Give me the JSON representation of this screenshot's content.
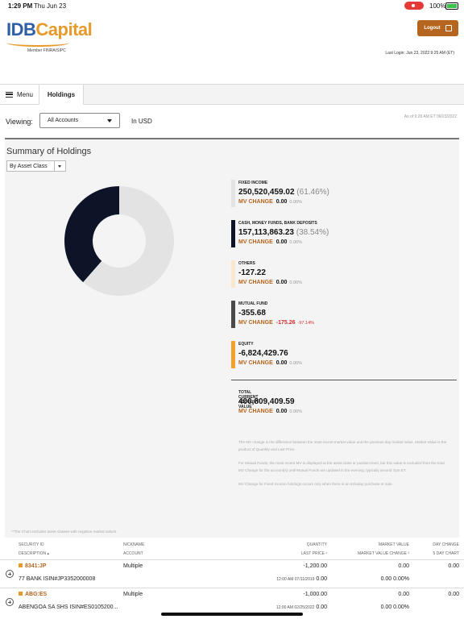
{
  "status_bar": {
    "time": "1:29 PM",
    "date": "Thu Jun 23",
    "battery": "100%"
  },
  "header": {
    "logo_idb": "IDB",
    "logo_capital": "Capital",
    "member": "Member FINRA/SIPC",
    "logout_label": "Logout",
    "last_login": "Last Login: Jun 23, 2022 9:25 AM (ET)"
  },
  "tabs": {
    "menu": "Menu",
    "holdings": "Holdings"
  },
  "toolbar": {
    "viewing_label": "Viewing:",
    "account_select": "All Accounts",
    "currency": "In USD",
    "as_of": "As of 9:29 AM ET 06/23/2022"
  },
  "summary": {
    "title": "Summary of Holdings",
    "group_by": "By Asset Class",
    "mv_change_label": "MV CHANGE",
    "items": [
      {
        "category": "FIXED INCOME",
        "value": "250,520,459.02",
        "pct": "(61.46%)",
        "mv_change": "0.00",
        "mv_pct": "0.00%",
        "color": "#e3e3e3"
      },
      {
        "category": "CASH, MONEY FUNDS, BANK DEPOSITS",
        "value": "157,113,863.23",
        "pct": "(38.54%)",
        "mv_change": "0.00",
        "mv_pct": "0.00%",
        "color": "#0d1428"
      },
      {
        "category": "OTHERS",
        "value": "-127.22",
        "pct": "",
        "mv_change": "0.00",
        "mv_pct": "0.00%",
        "color": "#fbe6cf"
      },
      {
        "category": "MUTUAL FUND",
        "value": "-355.68",
        "pct": "",
        "mv_change": "-175.26",
        "mv_pct": "-97.14%",
        "color": "#4a4a4a"
      },
      {
        "category": "EQUITY",
        "value": "-6,824,429.76",
        "pct": "",
        "mv_change": "0.00",
        "mv_pct": "0.00%",
        "color": "#f2a22c"
      }
    ],
    "total": {
      "label": "TOTAL CURRENT ACCOUNT VALUE",
      "value": "400,809,409.59",
      "mv_change": "0.00",
      "mv_pct": "0.00%"
    },
    "notes": [
      "The MV change is the difference between the most recent market value and the previous day market value. Market Value is the product of Quantity and Last Price.",
      "For Mutual Funds, the most recent MV is displayed at the asset class or position level, but this value is excluded from the total MV Change for the account(s) until Mutual Funds are updated in the evening, typically around 7pm ET.",
      "MV Change for Fixed Income holdings occurs only when there is an intraday purchase or sale."
    ],
    "chart_note": "**The Chart excludes asset classes with negative market values."
  },
  "chart_data": {
    "type": "pie",
    "style": "donut",
    "categories": [
      "FIXED INCOME",
      "CASH, MONEY FUNDS, BANK DEPOSITS"
    ],
    "values": [
      61.46,
      38.54
    ],
    "colors": [
      "#e3e3e3",
      "#0d1428"
    ]
  },
  "table": {
    "headers": {
      "security_id": "SECURITY ID",
      "description": "DESCRIPTION",
      "nickname": "NICKNAME",
      "account": "ACCOUNT",
      "quantity": "QUANTITY",
      "last_price": "LAST PRICE",
      "market_value": "MARKET VALUE",
      "market_value_change": "MARKET VALUE CHANGE",
      "day_change": "DAY CHANGE",
      "five_day": "5 DAY CHART"
    },
    "rows": [
      {
        "symbol": "8341:JP",
        "description": "77 BANK ISIN#JP3352000008",
        "nickname": "Multiple",
        "quantity": "-1,200.00",
        "price_time": "12:00 AM 07/11/2019",
        "last_price": "0.00",
        "market_value": "0.00",
        "mv_change": "0.00",
        "mv_change_pct": "0.00%",
        "day_change": "0.00"
      },
      {
        "symbol": "ABG:ES",
        "description": "ABENGOA SA SHS ISIN#ES0105200...",
        "nickname": "Multiple",
        "quantity": "-1,000.00",
        "price_time": "12:00 AM 02/25/2022",
        "last_price": "0.00",
        "market_value": "0.00",
        "mv_change": "0.00",
        "mv_change_pct": "0.00%",
        "day_change": "0.00"
      }
    ]
  }
}
